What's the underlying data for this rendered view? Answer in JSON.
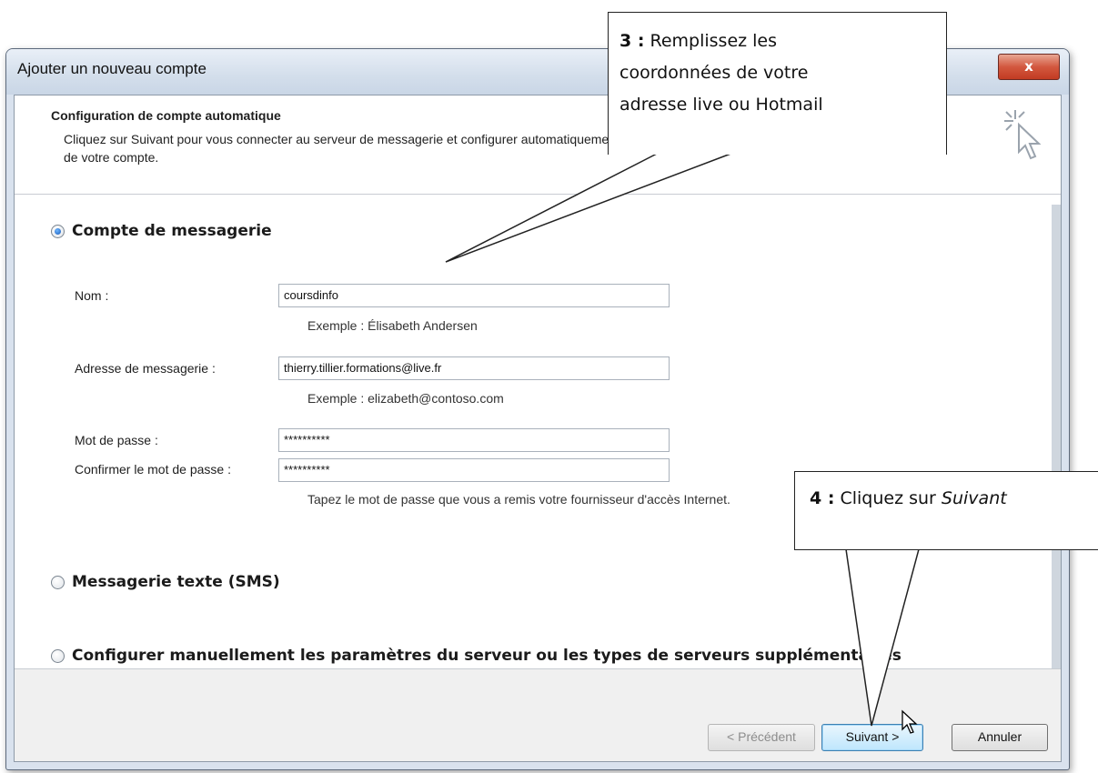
{
  "window": {
    "title": "Ajouter un nouveau compte",
    "close_label": "x"
  },
  "header": {
    "title": "Configuration de compte automatique",
    "description": "Cliquez sur Suivant pour vous connecter au serveur de messagerie et configurer automatiquement les paramètres de votre compte."
  },
  "options": {
    "email_account": "Compte de messagerie",
    "sms": "Messagerie texte (SMS)",
    "manual": "Configurer manuellement les paramètres du serveur ou les types de serveurs supplémentaires"
  },
  "form": {
    "name_label": "Nom :",
    "name_value": "coursdinfo",
    "name_hint": "Exemple : Élisabeth Andersen",
    "email_label": "Adresse de messagerie :",
    "email_value": "thierry.tillier.formations@live.fr",
    "email_hint": "Exemple : elizabeth@contoso.com",
    "password_label": "Mot de passe :",
    "password_value": "**********",
    "confirm_label": "Confirmer le mot de passe :",
    "confirm_value": "**********",
    "password_hint": "Tapez le mot de passe que vous a remis votre fournisseur d'accès Internet."
  },
  "buttons": {
    "previous": "< Précédent",
    "next": "Suivant >",
    "cancel": "Annuler"
  },
  "callouts": {
    "c3_number": "3 :",
    "c3_line1": "Remplissez les",
    "c3_line2": "coordonnées de votre",
    "c3_line3": "adresse live ou Hotmail",
    "c4_number": "4 :",
    "c4_text": "Cliquez sur",
    "c4_emphasis": "Suivant"
  }
}
